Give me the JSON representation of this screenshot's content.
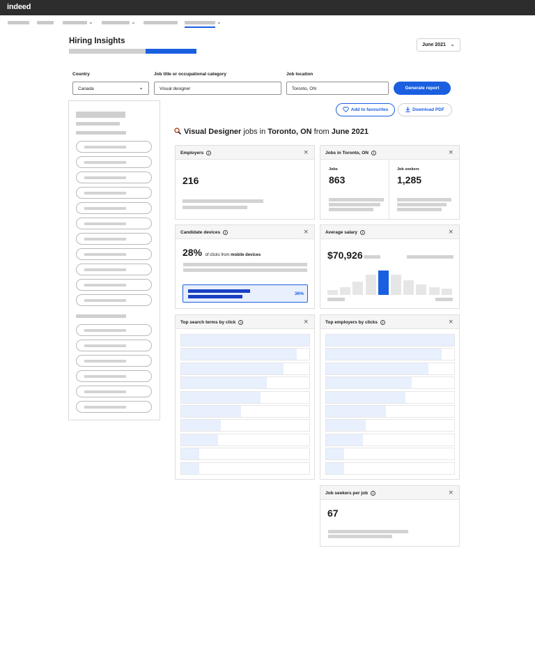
{
  "app": {
    "logo": "indeed"
  },
  "header": {
    "title": "Hiring Insights"
  },
  "date_select": {
    "value": "June 2021"
  },
  "filters": {
    "country_label": "Country",
    "country_value": "Canada",
    "job_label": "Job title or occupational category",
    "job_value": "Visual designer",
    "location_label": "Job location",
    "location_value": "Toronto, ON"
  },
  "actions": {
    "generate": "Generate report",
    "favourite": "Add to favourites",
    "download": "Download PDF"
  },
  "headline": {
    "job": "Visual Designer",
    "jobs_in": " jobs in ",
    "place": "Toronto, ON",
    "from": " from ",
    "date": "June 2021"
  },
  "cards": {
    "employers": {
      "title": "Employers",
      "value": "216"
    },
    "jobs": {
      "title": "Jobs in Toronto, ON",
      "jobs_label": "Jobs",
      "jobs_value": "863",
      "seekers_label": "Job seekers",
      "seekers_value": "1,285"
    },
    "devices": {
      "title": "Candidate devices",
      "percent": "28%",
      "text_pre": "of clicks from ",
      "text_bold": "mobile devices",
      "bar_percent": "36%"
    },
    "salary": {
      "title": "Average salary",
      "value": "$70,926",
      "histogram": [
        0.2,
        0.3,
        0.55,
        0.82,
        1.0,
        0.82,
        0.6,
        0.42,
        0.3,
        0.25
      ]
    },
    "search_terms": {
      "title": "Top search terms by click",
      "bars": [
        1.0,
        0.9,
        0.8,
        0.67,
        0.62,
        0.47,
        0.31,
        0.29,
        0.14,
        0.14
      ]
    },
    "top_employers": {
      "title": "Top employers by clicks",
      "bars": [
        1.0,
        0.9,
        0.8,
        0.67,
        0.62,
        0.47,
        0.31,
        0.29,
        0.14,
        0.14
      ]
    },
    "seekers_per_job": {
      "title": "Job seekers per job",
      "value": "67"
    }
  },
  "colors": {
    "accent": "#1a5fe0",
    "topbar": "#2d2d2d",
    "placeholder": "#cfcfcf"
  },
  "icons": {
    "search": "search-icon",
    "heart": "heart-icon",
    "download": "download-icon",
    "info": "info-icon",
    "close": "close-icon",
    "chevron": "chevron-down-icon"
  }
}
